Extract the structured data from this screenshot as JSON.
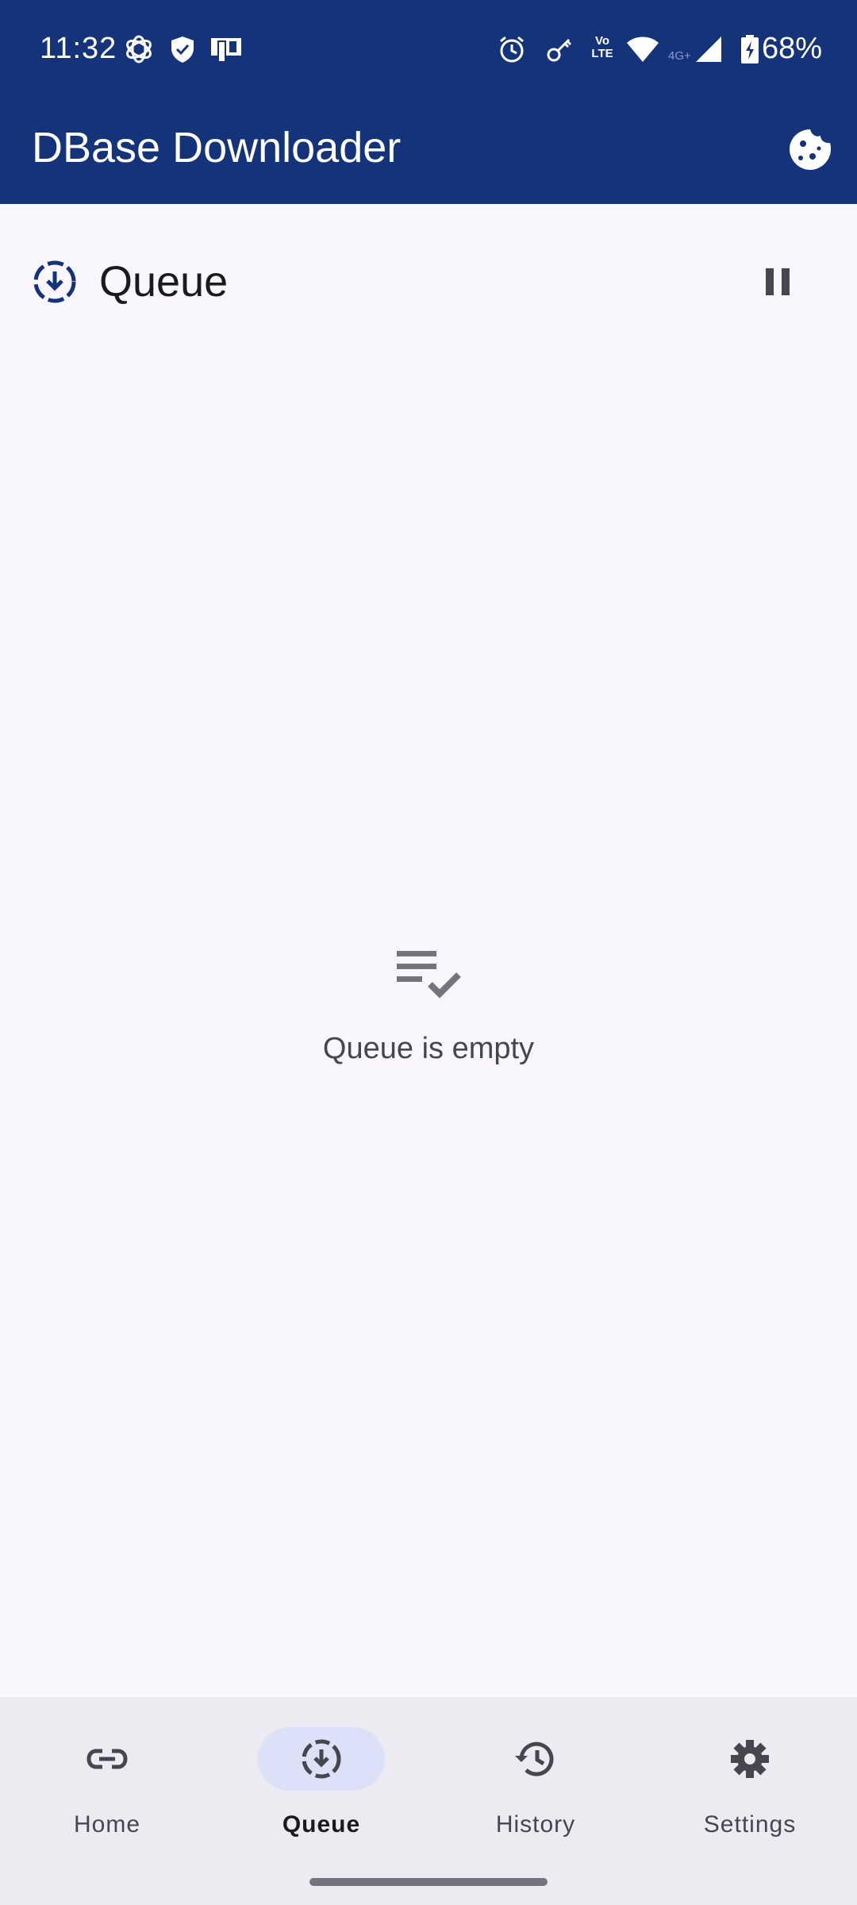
{
  "status_bar": {
    "time": "11:32",
    "network_label_top": "Vo",
    "network_label_bottom": "LTE",
    "signal_label": "4G+",
    "battery": "68%"
  },
  "app_bar": {
    "title": "DBase Downloader",
    "cookie_icon": "cookie-icon"
  },
  "queue": {
    "title": "Queue",
    "pause_icon": "pause-icon",
    "empty_message": "Queue is empty"
  },
  "bottom_nav": {
    "items": [
      {
        "label": "Home",
        "icon": "link-icon",
        "active": false
      },
      {
        "label": "Queue",
        "icon": "download-icon",
        "active": true
      },
      {
        "label": "History",
        "icon": "history-icon",
        "active": false
      },
      {
        "label": "Settings",
        "icon": "gear-icon",
        "active": false
      }
    ]
  },
  "colors": {
    "primary": "#15337a",
    "background": "#f9f7fd",
    "nav_background": "#ecebf1",
    "active_pill": "#dde1f8"
  }
}
